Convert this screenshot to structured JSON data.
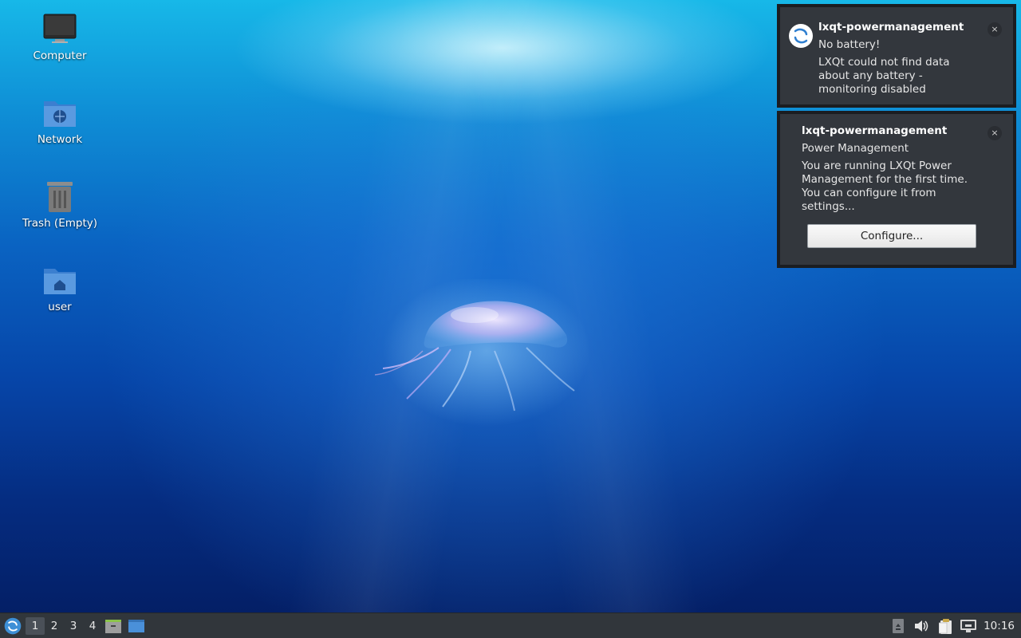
{
  "desktop": {
    "icons": [
      {
        "label": "Computer",
        "icon": "computer-icon"
      },
      {
        "label": "Network",
        "icon": "network-folder-icon"
      },
      {
        "label": "Trash (Empty)",
        "icon": "trash-icon"
      },
      {
        "label": "user",
        "icon": "home-folder-icon"
      }
    ]
  },
  "notifications": [
    {
      "app": "lxqt-powermanagement",
      "summary": "No battery!",
      "body": "LXQt could not find data about any battery - monitoring disabled",
      "close": "×"
    },
    {
      "app": "lxqt-powermanagement",
      "summary": "Power Management",
      "body": "You are running LXQt Power Management for the first time. You can configure it from settings...",
      "close": "×",
      "action_label": "Configure..."
    }
  ],
  "taskbar": {
    "workspaces": [
      "1",
      "2",
      "3",
      "4"
    ],
    "active_workspace": "1",
    "clock": "10:16"
  },
  "colors": {
    "taskbar_bg": "#31363b",
    "notification_bg": "#33373d",
    "accent": "#3d8fd6"
  }
}
